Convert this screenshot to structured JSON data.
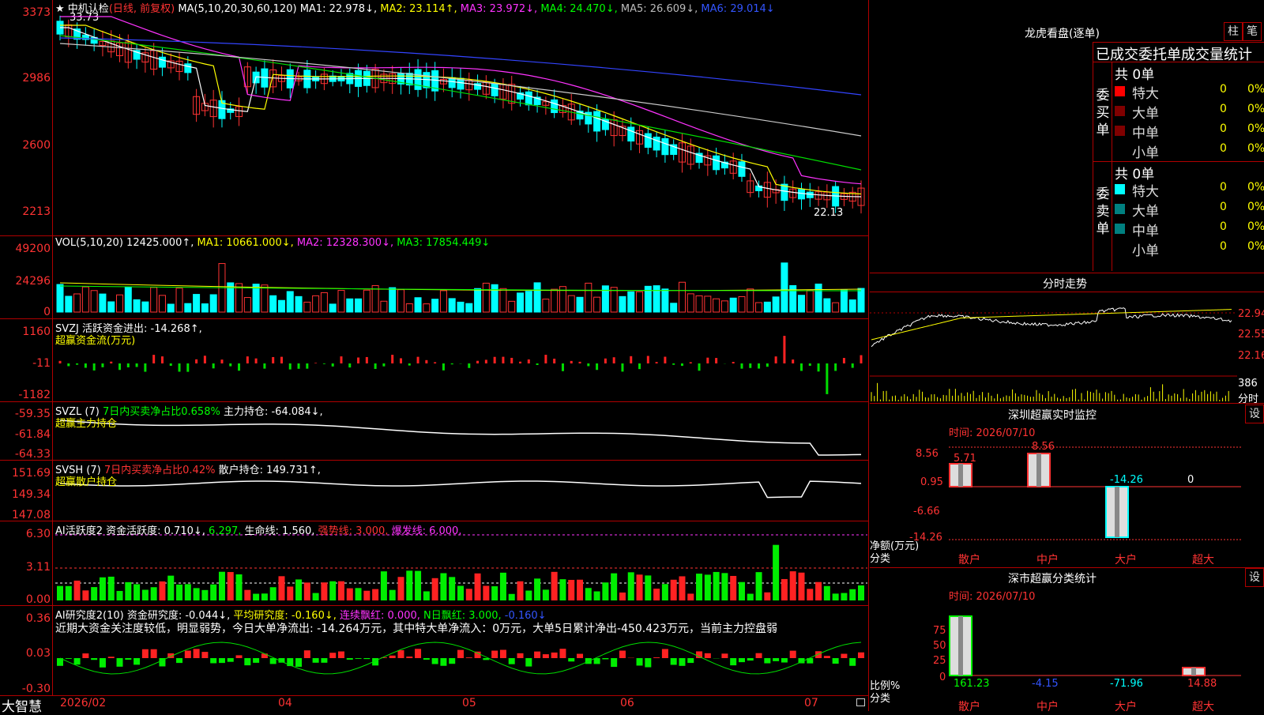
{
  "main_chart": {
    "price_axis": [
      "3373",
      "2986",
      "2600",
      "2213"
    ],
    "title_star": "★",
    "stock_name": "中机认检",
    "period": "(日线, 前复权)",
    "ma_label": "MA(5,10,20,30,60,120)",
    "ma1": "MA1: 22.978↓,",
    "ma2": "MA2: 23.114↑,",
    "ma3": "MA3: 23.972↓,",
    "ma4": "MA4: 24.470↓,",
    "ma5": "MA5: 26.609↓,",
    "ma6": "MA6: 29.014↓",
    "high_mark": "33.73",
    "low_mark": "22.13",
    "colors": {
      "up": "#ff3333",
      "down": "#00ffff"
    }
  },
  "vol_panel": {
    "axis": [
      "49200",
      "24296",
      "0"
    ],
    "label": "VOL(5,10,20)",
    "value": "12425.000↑,",
    "ma1": "MA1: 10661.000↓,",
    "ma2": "MA2: 12328.300↓,",
    "ma3": "MA3: 17854.449↓"
  },
  "svzj_panel": {
    "axis": [
      "1160",
      "-11",
      "-1182"
    ],
    "label": "SVZJ",
    "text": "活跃资金进出: -14.268↑,",
    "sub": "超赢资金流(万元)"
  },
  "svzl_panel": {
    "axis": [
      "-59.35",
      "-61.84",
      "-64.33"
    ],
    "label": "SVZL (7)",
    "ratio": "7日内买卖净占比0.658%",
    "hold": "主力持仓: -64.084↓,",
    "sub": "超赢主力持仓"
  },
  "svsh_panel": {
    "axis": [
      "151.69",
      "149.34",
      "147.08"
    ],
    "label": "SVSH (7)",
    "ratio": "7日内买卖净占比0.42%",
    "hold": "散户持仓: 149.731↑,",
    "sub": "超赢散户持仓"
  },
  "ai_active_panel": {
    "axis": [
      "6.30",
      "3.11",
      "0.00"
    ],
    "label": "AI活跃度2",
    "v1": "资金活跃度: 0.710↓,",
    "v2": "6.297,",
    "v3": "生命线: 1.560,",
    "v4": "强势线: 3.000,",
    "v5": "爆发线: 6.000,"
  },
  "ai_research_panel": {
    "axis": [
      "0.36",
      "0.03",
      "-0.30"
    ],
    "label": "AI研究度2(10)",
    "v1": "资金研究度: -0.044↓,",
    "v2": "平均研究度: -0.160↓,",
    "v3": "连续飘红: 0.000,",
    "v4": "N日飘红: 3.000,",
    "v5": "-0.160↓",
    "note": "近期大资金关注度较低，明显弱势，今日大单净流出: -14.264万元，其中特大单净流入：0万元，大单5日累计净出-450.423万元，当前主力控盘弱"
  },
  "time_axis": {
    "brand": "大智慧",
    "labels": [
      "2026/02",
      "04",
      "05",
      "06",
      "07"
    ]
  },
  "dragon_tiger": {
    "title": "龙虎看盘(逐单)",
    "btn1": "柱",
    "btn2": "笔",
    "header": "已成交委托单成交量统计",
    "buy_label": "委买单",
    "sell_label": "委卖单",
    "buy_total": "共 0单",
    "sell_total": "共 0单",
    "buy_rows": [
      {
        "name": "特大",
        "count": "0",
        "pct": "0%",
        "color": "#ff0000"
      },
      {
        "name": "大单",
        "count": "0",
        "pct": "0%",
        "color": "#800000"
      },
      {
        "name": "中单",
        "count": "0",
        "pct": "0%",
        "color": "#800000"
      },
      {
        "name": "小单",
        "count": "0",
        "pct": "0%",
        "color": "#000000"
      }
    ],
    "sell_rows": [
      {
        "name": "特大",
        "count": "0",
        "pct": "0%",
        "color": "#00ffff"
      },
      {
        "name": "大单",
        "count": "0",
        "pct": "0%",
        "color": "#008080"
      },
      {
        "name": "中单",
        "count": "0",
        "pct": "0%",
        "color": "#008080"
      },
      {
        "name": "小单",
        "count": "0",
        "pct": "0%",
        "color": "#000000"
      }
    ]
  },
  "intraday": {
    "title": "分时走势",
    "axis": [
      "22.94",
      "22.55",
      "22.16"
    ],
    "vol_axis": [
      "386",
      "分时"
    ]
  },
  "sz_monitor": {
    "title": "深圳超赢实时监控",
    "btn": "设",
    "time": "时间: 2026/07/10",
    "axis": [
      "8.56",
      "0.95",
      "-6.66",
      "-14.26"
    ],
    "axis_title_1": "净额(万元)",
    "axis_title_2": "分类",
    "categories": [
      "散户",
      "中户",
      "大户",
      "超大"
    ],
    "values": [
      5.71,
      8.56,
      -14.26,
      0
    ],
    "value_labels": [
      "5.71",
      "8.56",
      "-14.26",
      "0"
    ]
  },
  "sz_stats": {
    "title": "深市超赢分类统计",
    "btn": "设",
    "time": "时间: 2026/07/10",
    "axis": [
      "75",
      "50",
      "25",
      "0"
    ],
    "axis_title_1": "比例%",
    "axis_title_2": "分类",
    "categories": [
      "散户",
      "中户",
      "大户",
      "超大"
    ],
    "values": [
      161.23,
      -4.15,
      -71.96,
      14.88
    ],
    "value_labels": [
      "161.23",
      "-4.15",
      "-71.96",
      "14.88"
    ]
  }
}
